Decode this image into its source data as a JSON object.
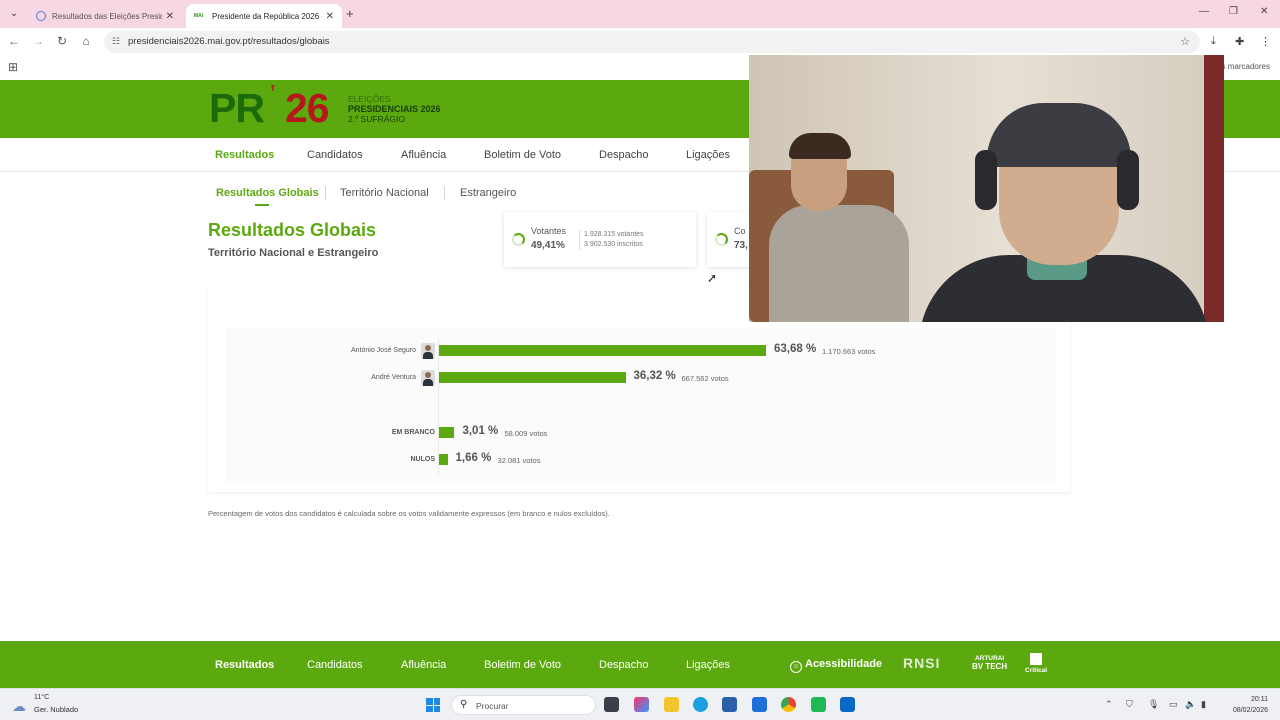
{
  "browser": {
    "tabs": [
      {
        "label": "Resultados das Eleições Preside"
      },
      {
        "label": "Presidente da República 2026 -"
      }
    ],
    "favicon_label": "MAI",
    "url": "presidenciais2026.mai.gov.pt/resultados/globais",
    "bookmarks_right": "s marcadores"
  },
  "site": {
    "logo": {
      "pr": "PR",
      "tick": "’",
      "num": "26",
      "line1": "ELEIÇÕES",
      "line2": "PRESIDENCIAIS 2026",
      "line3": "2.º SUFRÁGIO"
    },
    "nav": [
      "Resultados",
      "Candidatos",
      "Afluência",
      "Boletim de Voto",
      "Despacho",
      "Ligações"
    ],
    "subnav": [
      "Resultados Globais",
      "Território Nacional",
      "Estrangeiro"
    ],
    "title": "Resultados Globais",
    "subtitle": "Território Nacional e Estrangeiro",
    "stats": [
      {
        "label": "Votantes",
        "value": "49,41%",
        "detail1": "1.928.315 votantes",
        "detail2": "3.902.530 inscritos"
      },
      {
        "label": "Co",
        "value": "73,"
      }
    ]
  },
  "chart_data": {
    "type": "bar",
    "categories": [
      "António José Seguro",
      "André Ventura",
      "EM BRANCO",
      "NULOS"
    ],
    "values": [
      63.68,
      36.32,
      3.01,
      1.66
    ],
    "pct_labels": [
      "63,68 %",
      "36,32 %",
      "3,01 %",
      "1,66 %"
    ],
    "votes_labels": [
      "1.170.663 votos",
      "667.562 votos",
      "58.009 votos",
      "32.081 votos"
    ],
    "xlim": [
      0,
      63.68
    ],
    "color": "#5ca90f"
  },
  "footnote": "Percentagem de votos dos candidatos é calculada sobre os votos validamente expressos (em branco e nulos excluídos).",
  "footer": {
    "nav": [
      "Resultados",
      "Candidatos",
      "Afluência",
      "Boletim de Voto",
      "Despacho",
      "Ligações"
    ],
    "accessibility": "Acessibilidade",
    "partners": {
      "rnsi": "RNSI",
      "art1": "ARTURAI",
      "art2": "BV TECH",
      "crit": "Critical"
    }
  },
  "taskbar": {
    "temp": "11°C",
    "weather": "Ger. Nublado",
    "search_placeholder": "Procurar",
    "time": "20:11",
    "date": "08/02/2026"
  },
  "colors": {
    "accent": "#5ca90f",
    "logo_red": "#b3191b",
    "logo_green": "#1c6b0a"
  }
}
